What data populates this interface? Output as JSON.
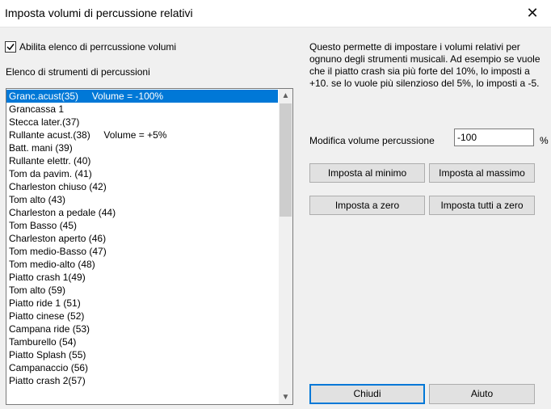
{
  "window": {
    "title": "Imposta volumi di percussione relativi",
    "close_glyph": "✕"
  },
  "enable_checkbox": {
    "label": "Abilita elenco di perrcussione volumi",
    "checked": true
  },
  "list_label": "Elenco di strumenti di percussioni",
  "list": {
    "items": [
      "Granc.acust(35)     Volume = -100%",
      "Grancassa 1",
      "Stecca later.(37)",
      "Rullante acust.(38)     Volume = +5%",
      "Batt. mani (39)",
      "Rullante elettr. (40)",
      "Tom da pavim. (41)",
      "Charleston chiuso (42)",
      "Tom alto (43)",
      "Charleston a pedale (44)",
      "Tom Basso (45)",
      "Charleston aperto (46)",
      "Tom medio-Basso (47)",
      "Tom medio-alto (48)",
      "Piatto crash 1(49)",
      "Tom alto (59)",
      "Piatto ride 1 (51)",
      "Piatto cinese (52)",
      "Campana ride (53)",
      "Tamburello (54)",
      "Piatto Splash (55)",
      "Campanaccio (56)",
      "Piatto crash 2(57)"
    ],
    "selected_index": 0,
    "scroll_up_glyph": "▲",
    "scroll_down_glyph": "▼"
  },
  "description": "Questo permette di impostare i volumi relativi per ognuno degli strumenti musicali. Ad esempio se vuole che il piatto crash sia più forte del 10%, lo imposti a +10. se lo vuole più silenzioso del 5%, lo imposti a -5.",
  "modify": {
    "label": "Modifica volume percussione",
    "value": "-100",
    "unit": "%"
  },
  "buttons": {
    "min": "Imposta al minimo",
    "max": "Imposta al massimo",
    "zero": "Imposta a zero",
    "all_zero": "Imposta tutti a zero",
    "close": "Chiudi",
    "help": "Aiuto"
  },
  "colors": {
    "selection": "#0078d7",
    "background": "#f0f0f0"
  }
}
